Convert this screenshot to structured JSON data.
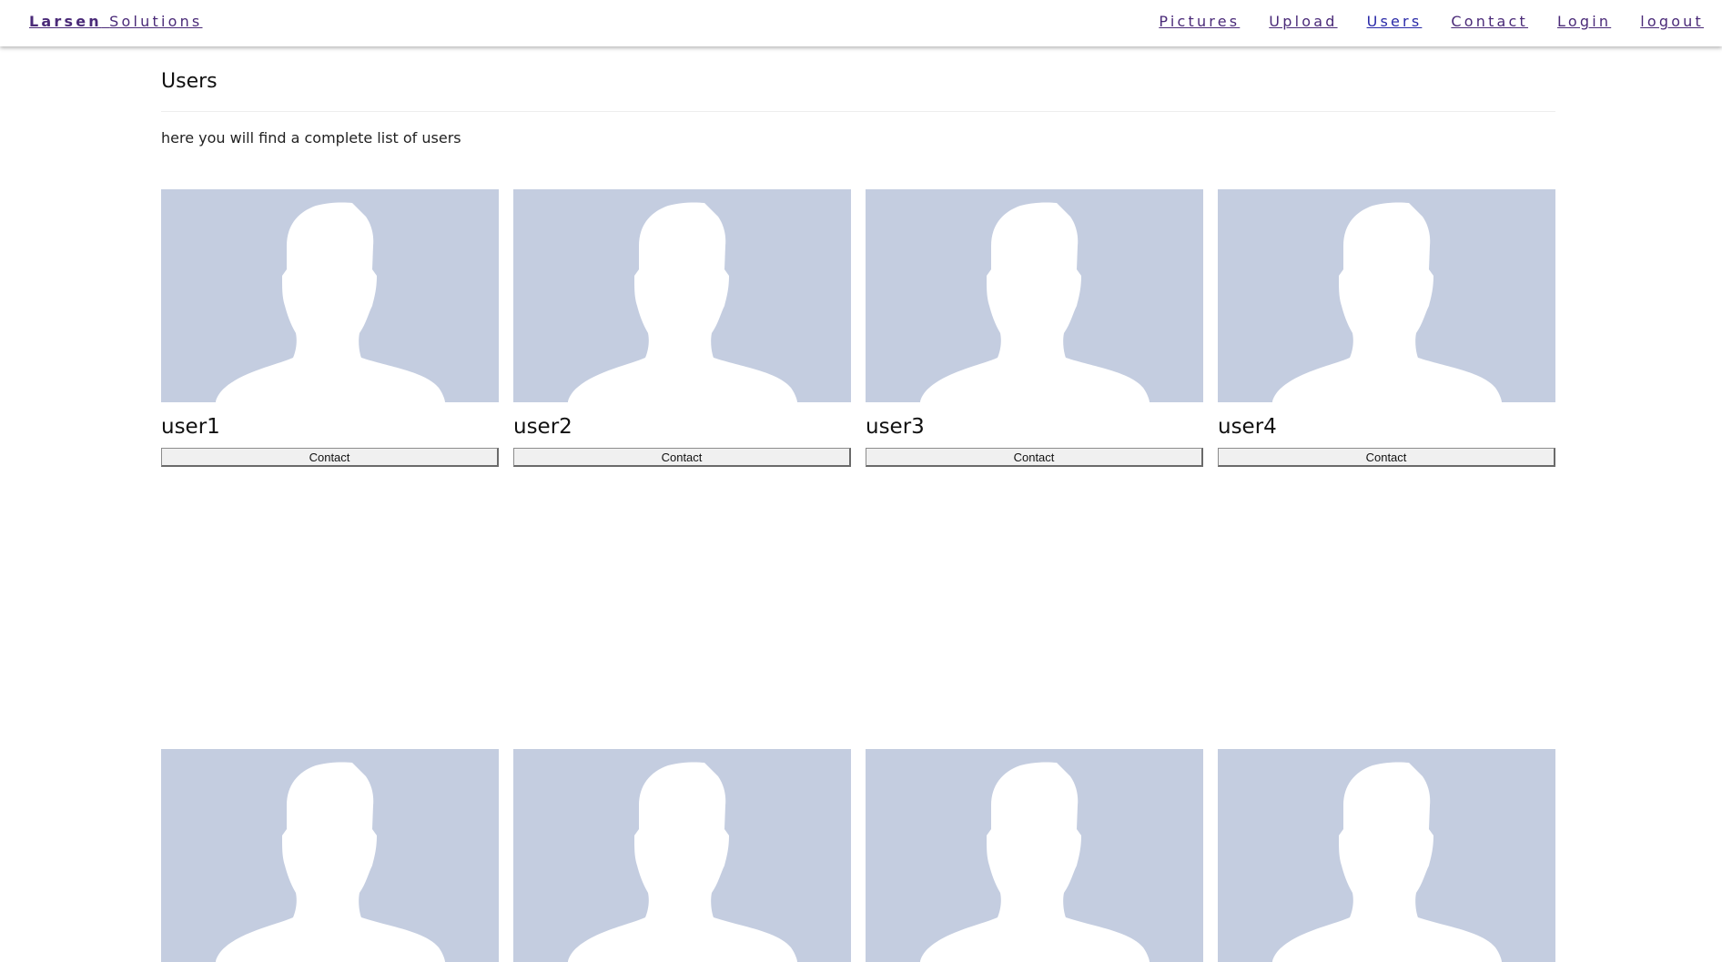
{
  "brand": {
    "name_bold": "Larsen",
    "name_rest": "Solutions"
  },
  "nav": {
    "items": [
      {
        "label": "Pictures"
      },
      {
        "label": "Upload"
      },
      {
        "label": "Users",
        "active": true
      },
      {
        "label": "Contact"
      },
      {
        "label": "Login"
      },
      {
        "label": "logout"
      }
    ]
  },
  "page": {
    "title": "Users",
    "subtitle": "here you will find a complete list of users"
  },
  "users": [
    {
      "name": "user1",
      "button_label": "Contact",
      "avatar_icon": "person-silhouette-icon"
    },
    {
      "name": "user2",
      "button_label": "Contact",
      "avatar_icon": "person-silhouette-icon"
    },
    {
      "name": "user3",
      "button_label": "Contact",
      "avatar_icon": "person-silhouette-icon"
    },
    {
      "name": "user4",
      "button_label": "Contact",
      "avatar_icon": "person-silhouette-icon"
    }
  ],
  "partial_users_count_visible": 4,
  "colors": {
    "link": "#4a2a78",
    "active_link": "#2a2aa8",
    "avatar_bg": "#c4cde0",
    "silhouette": "#ffffff"
  }
}
